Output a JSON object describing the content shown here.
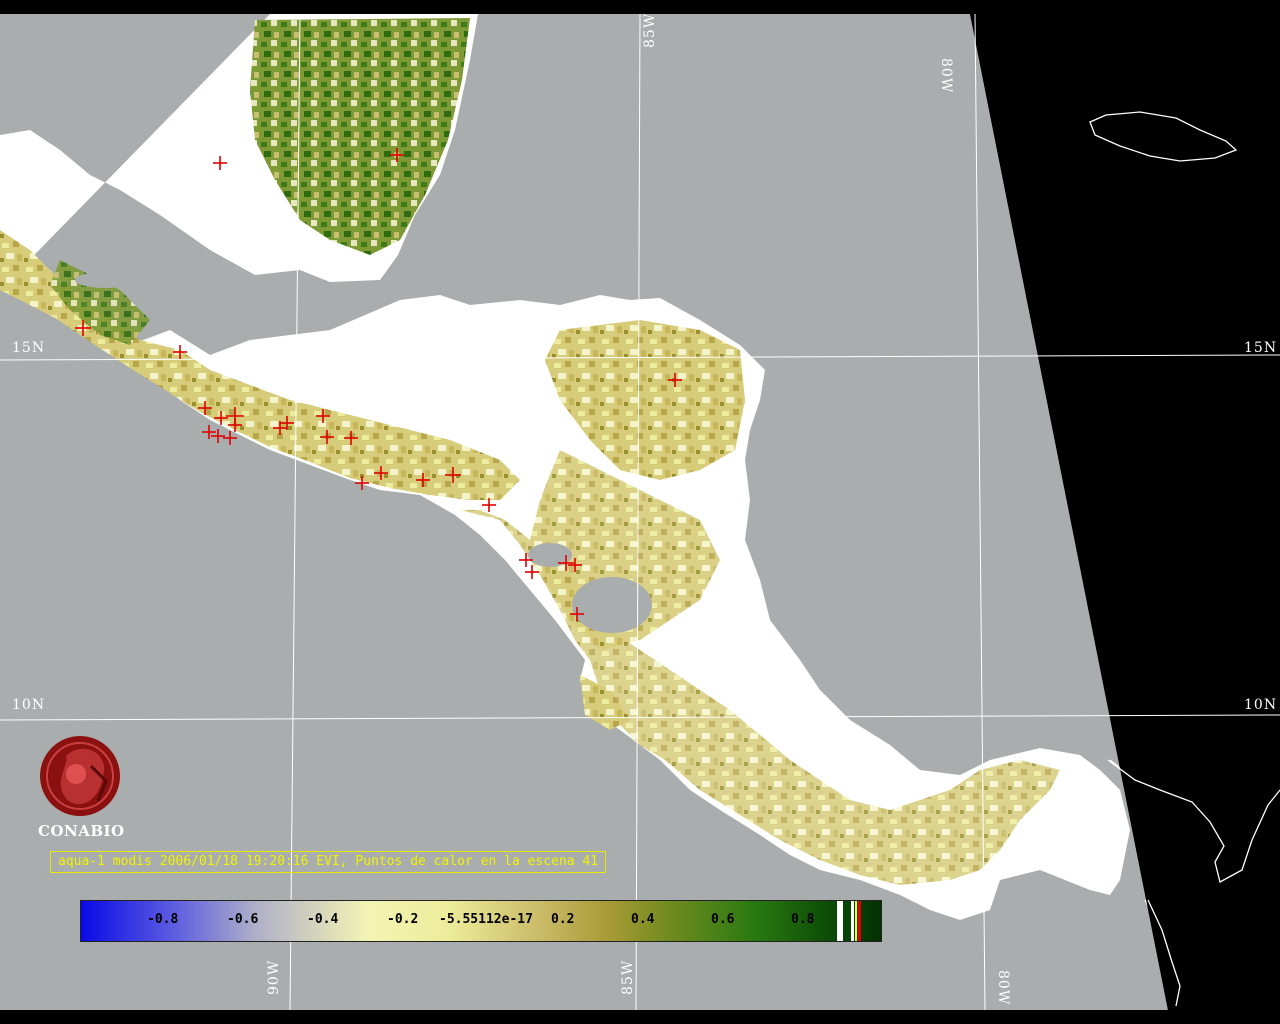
{
  "map": {
    "graticule_labels": {
      "lat_15": "15N",
      "lat_10": "10N",
      "lon_85_top": "85W",
      "lon_80_top": "80W",
      "lon_90_bottom": "90W",
      "lon_85_bottom": "85W",
      "lon_80_bottom": "80W"
    },
    "colors": {
      "background_outside_scene": "#000000",
      "water": "#a9adad",
      "cloud": "#ffffff",
      "hotspot": "#e00000",
      "coastline": "#ffffff",
      "grid": "#ffffff"
    }
  },
  "logo": {
    "text": "CONABIO"
  },
  "caption": {
    "text": "aqua-1 modis 2006/01/18 19:20:16 EVI, Puntos de calor en la escena 41"
  },
  "colorbar": {
    "ticks": [
      "-0.8",
      "-0.6",
      "-0.4",
      "-0.2",
      "-5.55112e-17",
      "0.2",
      "0.4",
      "0.6",
      "0.8"
    ],
    "extra_swatches": [
      "#ffffff",
      "#ffffff",
      "#ffff00",
      "#e00000"
    ]
  }
}
